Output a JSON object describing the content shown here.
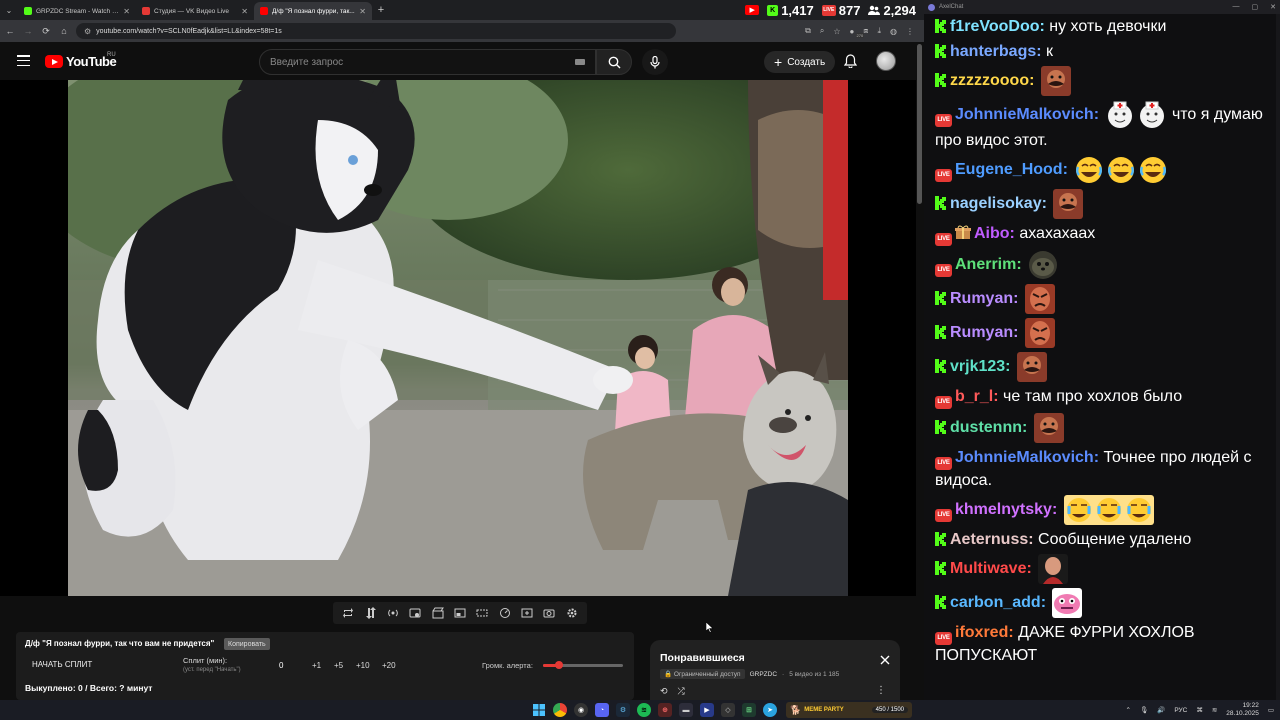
{
  "browser": {
    "tabs": [
      {
        "title": "GRPZDC Stream - Watch Live o...",
        "color": "#53fc18",
        "active": false
      },
      {
        "title": "Студия — VK Видео Live",
        "color": "#e53935",
        "active": false
      },
      {
        "title": "Д/ф \"Я познал фурри, так...",
        "color": "#ff0000",
        "active": true
      }
    ],
    "stats": {
      "kick_viewers": "1,417",
      "vk_viewers": "877",
      "total_viewers": "2,294"
    },
    "url": "youtube.com/watch?v=SCLN0fEadjk&list=LL&index=58t=1s",
    "extension_badge": "270"
  },
  "youtube": {
    "logo_text": "YouTube",
    "country": "RU",
    "search_placeholder": "Введите запрос",
    "create_label": "Создать"
  },
  "split": {
    "title": "Д/ф \"Я познал фурри, так что вам не придется\"",
    "copy_label": "Копировать",
    "start_label": "НАЧАТЬ СПЛИТ",
    "minutes_label": "Сплит (мин):",
    "minutes_hint": "(уст. перед \"Начать\")",
    "value": "0",
    "increments": [
      "+1",
      "+5",
      "+10",
      "+20"
    ],
    "alert_volume_label": "Громк. алерта:",
    "alert_volume": 0.2,
    "bought_text": "Выкуплено: 0 / Всего: ? минут"
  },
  "playlist": {
    "title": "Понравившиеся",
    "access": "Ограниченный доступ",
    "owner": "GRPZDC",
    "count": "5 видео из 1 185"
  },
  "chat": {
    "app_name": "AxelChat",
    "messages": [
      {
        "platform": "kick",
        "user": "f1reVooDoo",
        "color": "#7fe3ff",
        "text": "ну хоть девочки",
        "emotes": []
      },
      {
        "platform": "kick",
        "user": "hanterbags",
        "color": "#7aa8ff",
        "text": "к",
        "emotes": []
      },
      {
        "platform": "kick",
        "user": "zzzzzoooo",
        "color": "#ffd84a",
        "text": "",
        "emotes": [
          "mustache"
        ]
      },
      {
        "platform": "vk",
        "user": "JohnnieMalkovich",
        "color": "#5b8cff",
        "text": "что я думаю про видос этот.",
        "emotes": [
          "nurse",
          "nurse"
        ]
      },
      {
        "platform": "vk",
        "user": "Eugene_Hood",
        "color": "#4f9cff",
        "text": "",
        "emotes": [
          "laugh",
          "laugh",
          "laugh"
        ]
      },
      {
        "platform": "kick",
        "user": "nagelisokay",
        "color": "#9ad0ff",
        "text": "",
        "emotes": [
          "mustache"
        ]
      },
      {
        "platform": "vk",
        "gift": true,
        "user": "Aibo",
        "color": "#c05cff",
        "text": "ахахахаах",
        "emotes": []
      },
      {
        "platform": "vk",
        "user": "Anerrim",
        "color": "#5ee07a",
        "text": "",
        "emotes": [
          "seal"
        ]
      },
      {
        "platform": "kick",
        "user": "Rumyan",
        "color": "#b98cff",
        "text": "",
        "emotes": [
          "angry"
        ]
      },
      {
        "platform": "kick",
        "user": "Rumyan",
        "color": "#b98cff",
        "text": "",
        "emotes": [
          "angry"
        ]
      },
      {
        "platform": "kick",
        "user": "vrjk123",
        "color": "#5fe0c8",
        "text": "",
        "emotes": [
          "mustache"
        ]
      },
      {
        "platform": "vk",
        "user": "b_r_l",
        "color": "#ff5a5a",
        "text": "че там про хохлов было",
        "emotes": []
      },
      {
        "platform": "kick",
        "user": "dustennn",
        "color": "#5fe0a8",
        "text": "",
        "emotes": [
          "mustache"
        ]
      },
      {
        "platform": "vk",
        "user": "JohnnieMalkovich",
        "color": "#5b8cff",
        "text": "Точнее про людей с видоса.",
        "emotes": []
      },
      {
        "platform": "vk",
        "user": "khmelnytsky",
        "color": "#d071ff",
        "text": "",
        "emotes": [
          "cry3"
        ]
      },
      {
        "platform": "kick",
        "user": "Aeternuss",
        "color": "#e8c8c8",
        "text": "Сообщение удалено",
        "emotes": []
      },
      {
        "platform": "kick",
        "user": "Multiwave",
        "color": "#ff4a4a",
        "text": "",
        "emotes": [
          "bald"
        ]
      },
      {
        "platform": "kick",
        "user": "carbon_add",
        "color": "#5ab8ff",
        "text": "",
        "emotes": [
          "pink"
        ]
      },
      {
        "platform": "vk",
        "user": "ifoxred",
        "color": "#ff7a3a",
        "text": "ДАЖЕ ФУРРИ ХОХЛОВ ПОПУСКАЮТ",
        "emotes": []
      }
    ]
  },
  "taskbar": {
    "meme_label": "MEME PARTY",
    "meme_count": "450 / 1500",
    "lang": "РУС",
    "time": "19:22",
    "date": "28.10.2025"
  },
  "colors": {
    "kick": "#53fc18",
    "vk_live": "#e53935",
    "yt_red": "#ff0000"
  }
}
